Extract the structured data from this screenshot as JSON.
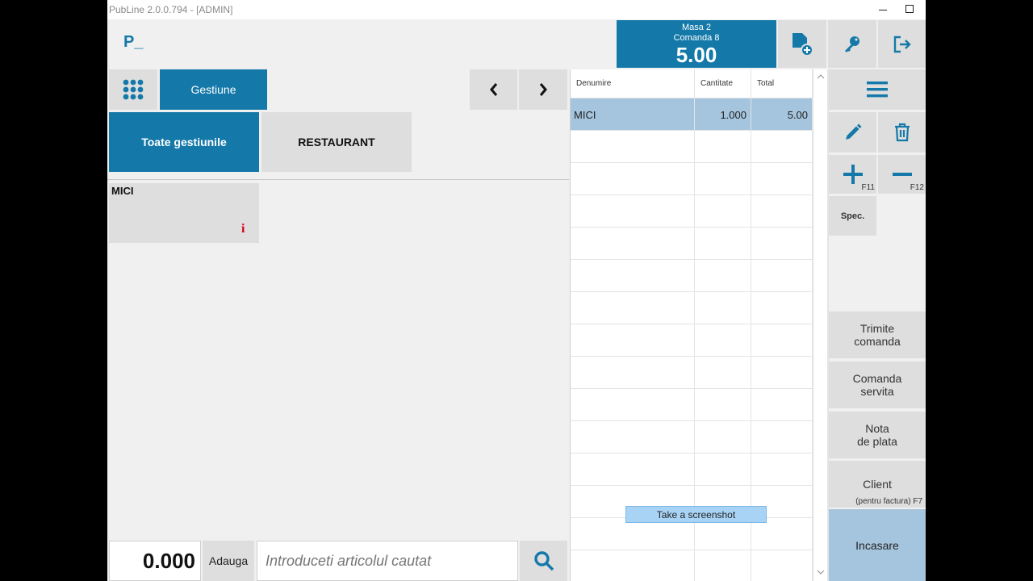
{
  "window": {
    "title": "PubLine 2.0.0.794 - [ADMIN]"
  },
  "header": {
    "logo": "P_",
    "table": "Masa 2",
    "order": "Comanda 8",
    "total": "5.00"
  },
  "categories": {
    "gestiune_label": "Gestiune",
    "tabs": [
      "Toate gestiunile",
      "RESTAURANT"
    ]
  },
  "products": [
    {
      "name": "MICI",
      "info_icon": "i"
    }
  ],
  "order_table": {
    "columns": [
      "Denumire",
      "Cantitate",
      "Total"
    ],
    "rows": [
      {
        "name": "MICI",
        "qty": "1.000",
        "total": "5.00"
      }
    ]
  },
  "side": {
    "plus_key": "F11",
    "minus_key": "F12",
    "spec": "Spec.",
    "send_order": [
      "Trimite",
      "comanda"
    ],
    "served": [
      "Comanda",
      "servita"
    ],
    "bill": [
      "Nota",
      "de plata"
    ],
    "client": "Client",
    "client_sub": "(pentru factura) F7",
    "pay": "Incasare"
  },
  "bottom": {
    "quantity": "0.000",
    "add_label": "Adauga",
    "search_placeholder": "Introduceti articolul cautat"
  },
  "tooltip": "Take a screenshot",
  "colors": {
    "accent": "#1479a9",
    "selected_row": "#a5c4dd",
    "pay": "#a5c4dd",
    "info": "#d9001b"
  }
}
